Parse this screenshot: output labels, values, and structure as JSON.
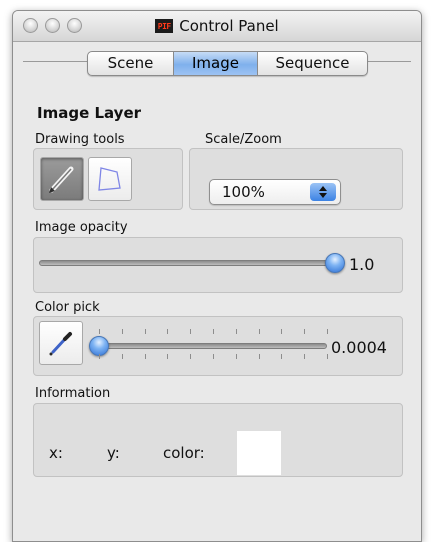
{
  "window": {
    "title": "Control Panel",
    "app_icon_text": "PIF"
  },
  "tabs": [
    {
      "label": "Scene",
      "selected": false
    },
    {
      "label": "Image",
      "selected": true
    },
    {
      "label": "Sequence",
      "selected": false
    }
  ],
  "panel": {
    "heading": "Image Layer",
    "drawing_tools": {
      "label": "Drawing tools",
      "tools": [
        {
          "icon": "pencil-icon",
          "pressed": true
        },
        {
          "icon": "polygon-icon",
          "pressed": false
        }
      ]
    },
    "scale_zoom": {
      "label": "Scale/Zoom",
      "value": "100%"
    },
    "image_opacity": {
      "label": "Image opacity",
      "value": 1.0,
      "value_text": "1.0",
      "slider_fraction": 1.0
    },
    "color_pick": {
      "label": "Color pick",
      "value_text": "0.0004",
      "slider_fraction": 0.0004,
      "tick_count": 11,
      "icon": "eyedropper-icon"
    },
    "information": {
      "label": "Information",
      "x_label": "x:",
      "y_label": "y:",
      "color_label": "color:",
      "swatch_color": "#ffffff"
    }
  },
  "colors": {
    "accent": "#4a8ef0",
    "window_bg": "#e9e9e9"
  }
}
